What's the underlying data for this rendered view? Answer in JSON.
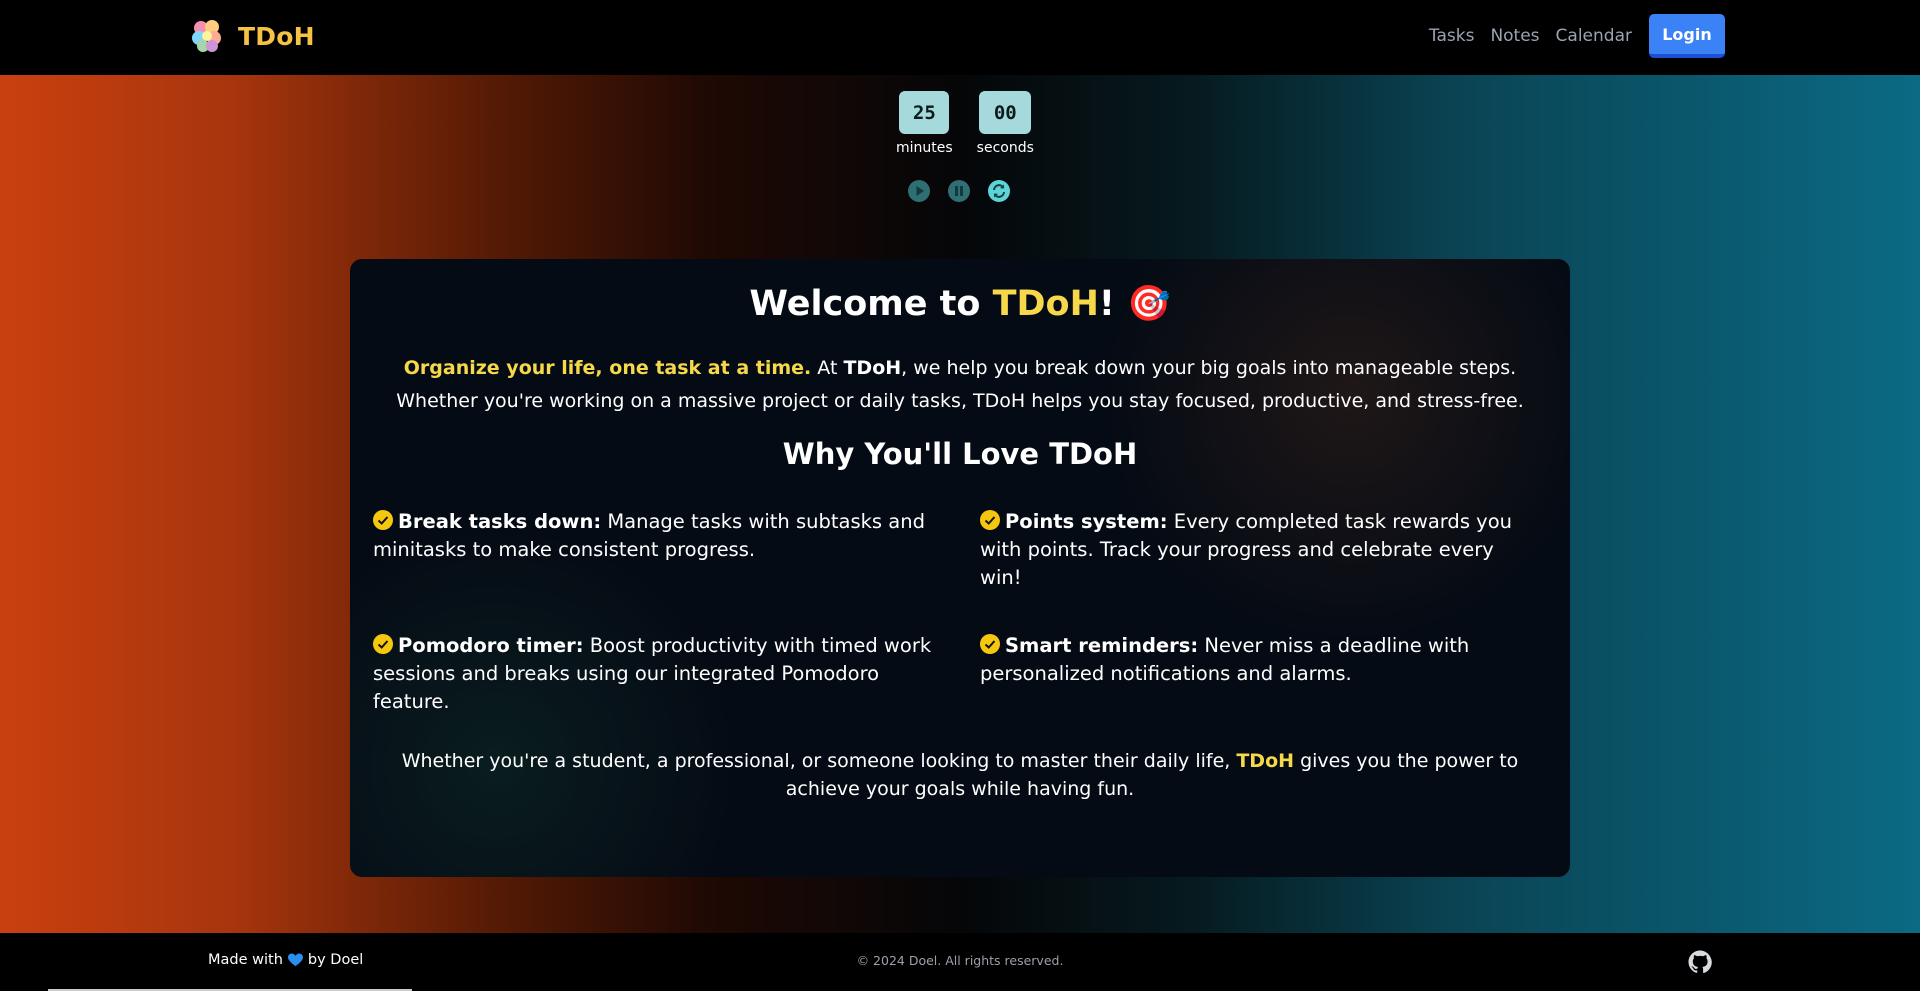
{
  "nav": {
    "brand": "TDoH",
    "logo_icon": "brain-icon",
    "links": [
      "Tasks",
      "Notes",
      "Calendar"
    ],
    "login_label": "Login"
  },
  "timer": {
    "minutes": "25",
    "seconds": "00",
    "minutes_label": "minutes",
    "seconds_label": "seconds",
    "controls": [
      "play-icon",
      "pause-icon",
      "reset-icon"
    ]
  },
  "card": {
    "title_prefix": "Welcome to ",
    "title_brand": "TDoH",
    "title_suffix": "!",
    "title_emoji": "🎯",
    "intro_highlight": "Organize your life, one task at a time.",
    "intro_at": " At ",
    "intro_brand": "TDoH",
    "intro_rest": ", we help you break down your big goals into manageable steps. Whether you're working on a massive project or daily tasks, TDoH helps you stay focused, productive, and stress-free.",
    "section_title": "Why You'll Love TDoH",
    "features": [
      {
        "title": "Break tasks down:",
        "text": " Manage tasks with subtasks and minitasks to make consistent progress."
      },
      {
        "title": "Points system:",
        "text": " Every completed task rewards you with points. Track your progress and celebrate every win!"
      },
      {
        "title": "Pomodoro timer:",
        "text": " Boost productivity with timed work sessions and breaks using our integrated Pomodoro feature."
      },
      {
        "title": "Smart reminders:",
        "text": " Never miss a deadline with personalized notifications and alarms."
      }
    ],
    "outro_start": "Whether you're a student, a professional, or someone looking to master their daily life, ",
    "outro_brand": "TDoH",
    "outro_end": " gives you the power to achieve your goals while having fun."
  },
  "footer": {
    "made_with": "Made with",
    "by": "by Doel",
    "copyright": "© 2024 Doel. All rights reserved.",
    "github_icon": "github-icon"
  },
  "colors": {
    "accent": "#f6d84a",
    "brand": "#f6c243",
    "login": "#3b82f6",
    "timer_box": "#a5d9db"
  }
}
